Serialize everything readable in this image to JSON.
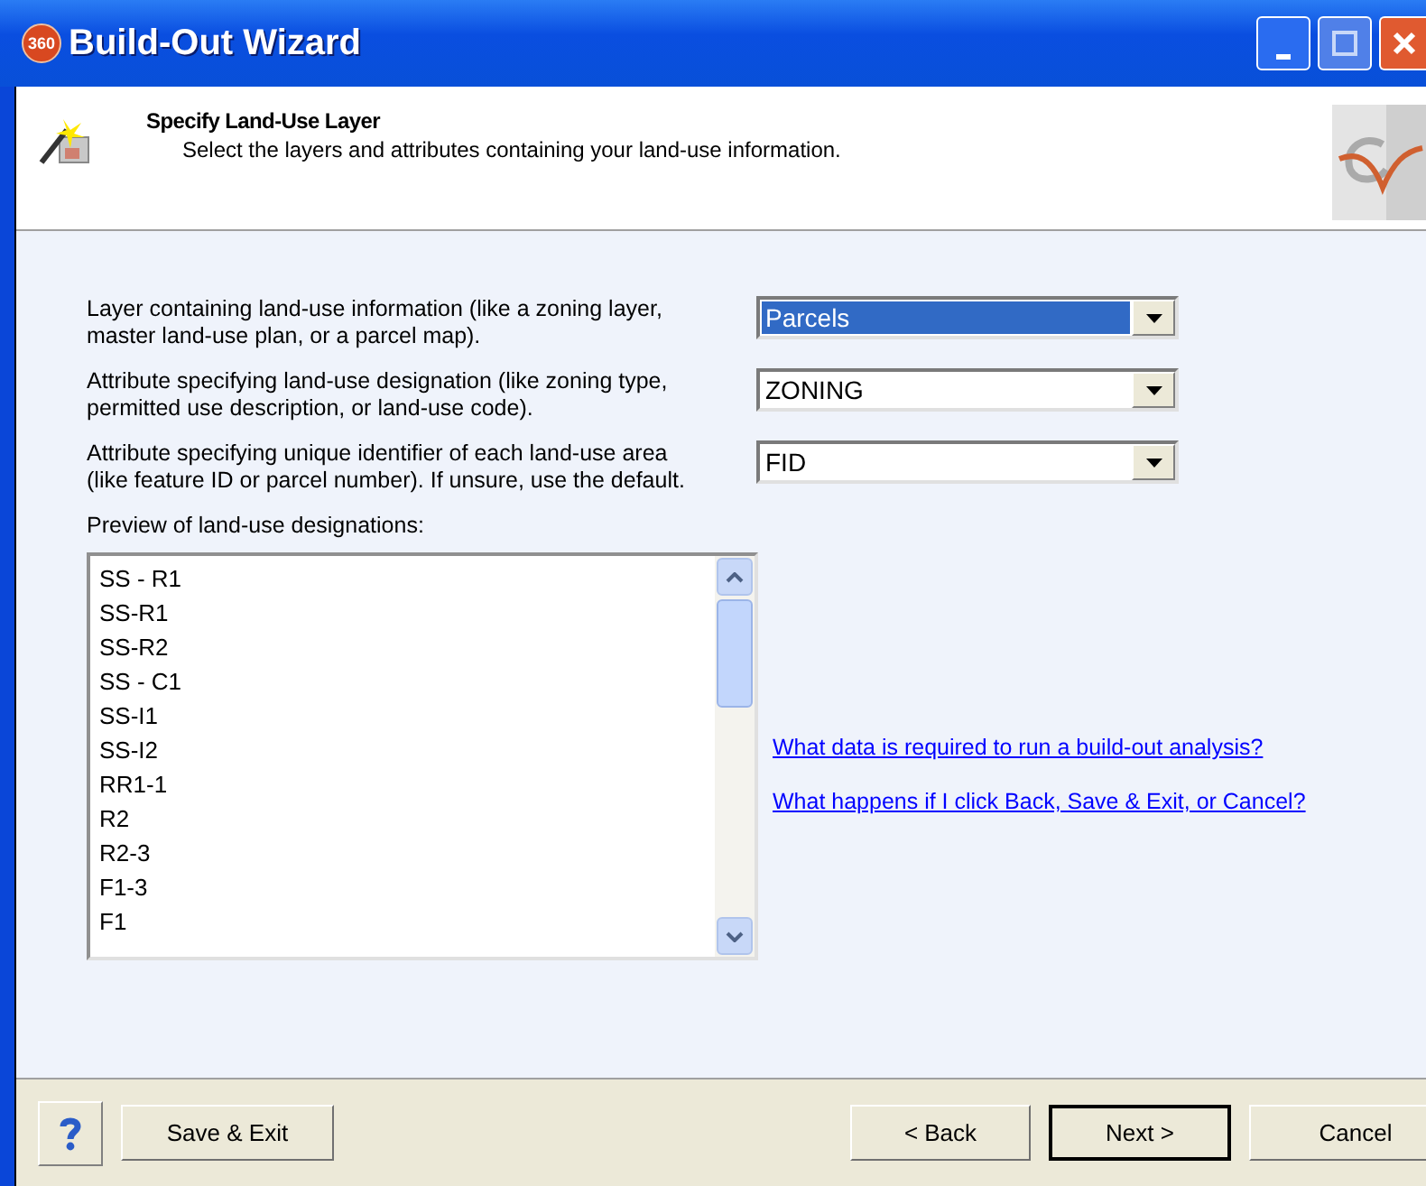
{
  "window": {
    "title": "Build-Out Wizard",
    "app_badge": "360"
  },
  "header": {
    "title": "Specify Land-Use Layer",
    "subtitle": "Select the layers and attributes containing your land-use information."
  },
  "fields": [
    {
      "label": "Layer containing land-use information (like a zoning layer, master land-use plan, or a parcel map).",
      "value": "Parcels",
      "focused": true
    },
    {
      "label": "Attribute specifying land-use designation (like zoning type, permitted use description, or land-use code).",
      "value": "ZONING",
      "focused": false
    },
    {
      "label": "Attribute specifying unique identifier of each land-use area (like feature ID or parcel number).  If unsure, use the default.",
      "value": "FID",
      "focused": false
    }
  ],
  "preview": {
    "label": "Preview of land-use designations:",
    "items": [
      "SS - R1",
      "SS-R1",
      "SS-R2",
      "SS - C1",
      "SS-I1",
      "SS-I2",
      "RR1-1",
      "R2",
      "R2-3",
      "F1-3",
      "F1"
    ]
  },
  "links": [
    "What data is required to run a build-out analysis?",
    "What happens if I click Back, Save & Exit, or Cancel?"
  ],
  "buttons": [
    {
      "label": "Save & Exit",
      "kind": "left",
      "default": false
    },
    {
      "label": "< Back",
      "kind": "right",
      "default": false
    },
    {
      "label": "Next >",
      "kind": "right",
      "default": true
    },
    {
      "label": "Cancel",
      "kind": "right",
      "default": false
    }
  ]
}
